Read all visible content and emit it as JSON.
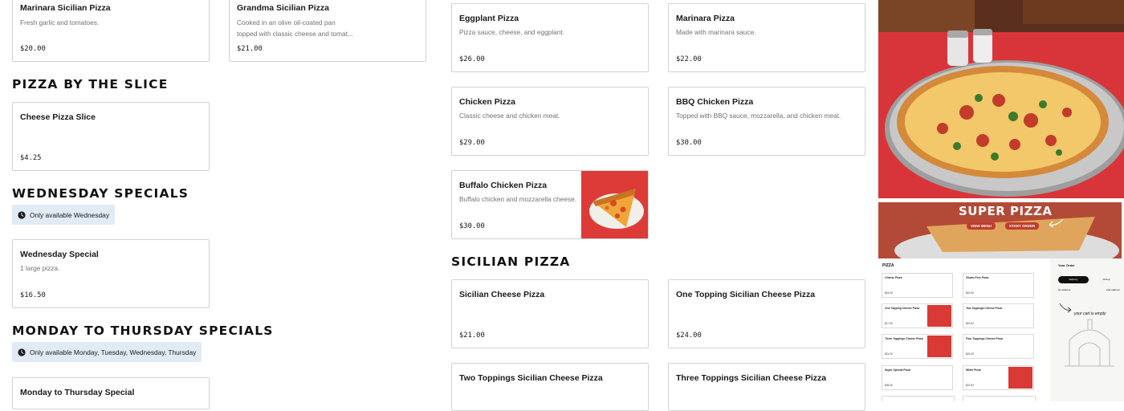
{
  "colors": {
    "accent_notice": "#e1ebf6",
    "thumb_red": "#dd3b37",
    "page_bg": "#ffffff"
  },
  "col1_top": [
    {
      "name": "Marinara Sicilian Pizza",
      "desc": "Fresh garlic and tomatoes.",
      "price": "$20.00"
    },
    {
      "name": "Grandma Sicilian Pizza",
      "desc": "Cooked in an olive oil-coated pan topped with classic cheese and tomat...",
      "price": "$21.00"
    }
  ],
  "slice": {
    "title": "PIZZA BY THE SLICE",
    "items": [
      {
        "name": "Cheese Pizza Slice",
        "desc": "",
        "price": "$4.25"
      }
    ]
  },
  "wednesday": {
    "title": "WEDNESDAY SPECIALS",
    "notice": "Only available Wednesday",
    "items": [
      {
        "name": "Wednesday Special",
        "desc": "1 large pizza.",
        "price": "$16.50"
      }
    ]
  },
  "mon_thu": {
    "title": "MONDAY TO THURSDAY SPECIALS",
    "notice": "Only available Monday, Tuesday, Wednesday, Thursday",
    "items": [
      {
        "name": "Monday to Thursday Special",
        "desc": "",
        "price": ""
      }
    ]
  },
  "col2": [
    {
      "name": "Eggplant Pizza",
      "desc": "Pizza sauce, cheese, and eggplant.",
      "price": "$26.00"
    },
    {
      "name": "Marinara Pizza",
      "desc": "Made with marinara sauce.",
      "price": "$22.00"
    },
    {
      "name": "Chicken Pizza",
      "desc": "Classic cheese and chicken meat.",
      "price": "$29.00"
    },
    {
      "name": "BBQ Chicken Pizza",
      "desc": "Topped with BBQ sauce, mozzarella, and chicken meat.",
      "price": "$30.00"
    },
    {
      "name": "Buffalo Chicken Pizza",
      "desc": "Buffalo chicken and mozzarella cheese.",
      "price": "$30.00"
    }
  ],
  "sicilian": {
    "title": "SICILIAN PIZZA",
    "items": [
      {
        "name": "Sicilian Cheese Pizza",
        "desc": "",
        "price": "$21.00"
      },
      {
        "name": "One Topping Sicilian Cheese Pizza",
        "desc": "",
        "price": "$24.00"
      },
      {
        "name": "Two Toppings Sicilian Cheese Pizza",
        "desc": "",
        "price": ""
      },
      {
        "name": "Three Toppings Sicilian Cheese Pizza",
        "desc": "",
        "price": ""
      }
    ]
  },
  "promo": {
    "headline": "SUPER PIZZA",
    "view_menu": "VIEW MENU",
    "start_order": "START ORDER",
    "screenshot": {
      "section": "PIZZA",
      "order_label": "Your Order",
      "tab_delivery": "Delivery",
      "tab_pickup": "Pickup",
      "no_address": "No address",
      "add_label": "Add address",
      "cart_empty": "your cart is empty",
      "items": [
        {
          "name": "Cheese Pizza",
          "price": "$16.00"
        },
        {
          "name": "Gluten Free Pizza",
          "price": "$19.00"
        },
        {
          "name": "One Topping Cheese Pizza",
          "price": "$17.00"
        },
        {
          "name": "Two Toppings Cheese Pizza",
          "price": "$19.00"
        },
        {
          "name": "Three Toppings Cheese Pizza",
          "price": "$21.00"
        },
        {
          "name": "Four Toppings Cheese Pizza",
          "price": "$23.00"
        },
        {
          "name": "Super Special Pizza",
          "price": "$26.00"
        },
        {
          "name": "White Pizza",
          "price": "$21.00"
        }
      ]
    }
  }
}
